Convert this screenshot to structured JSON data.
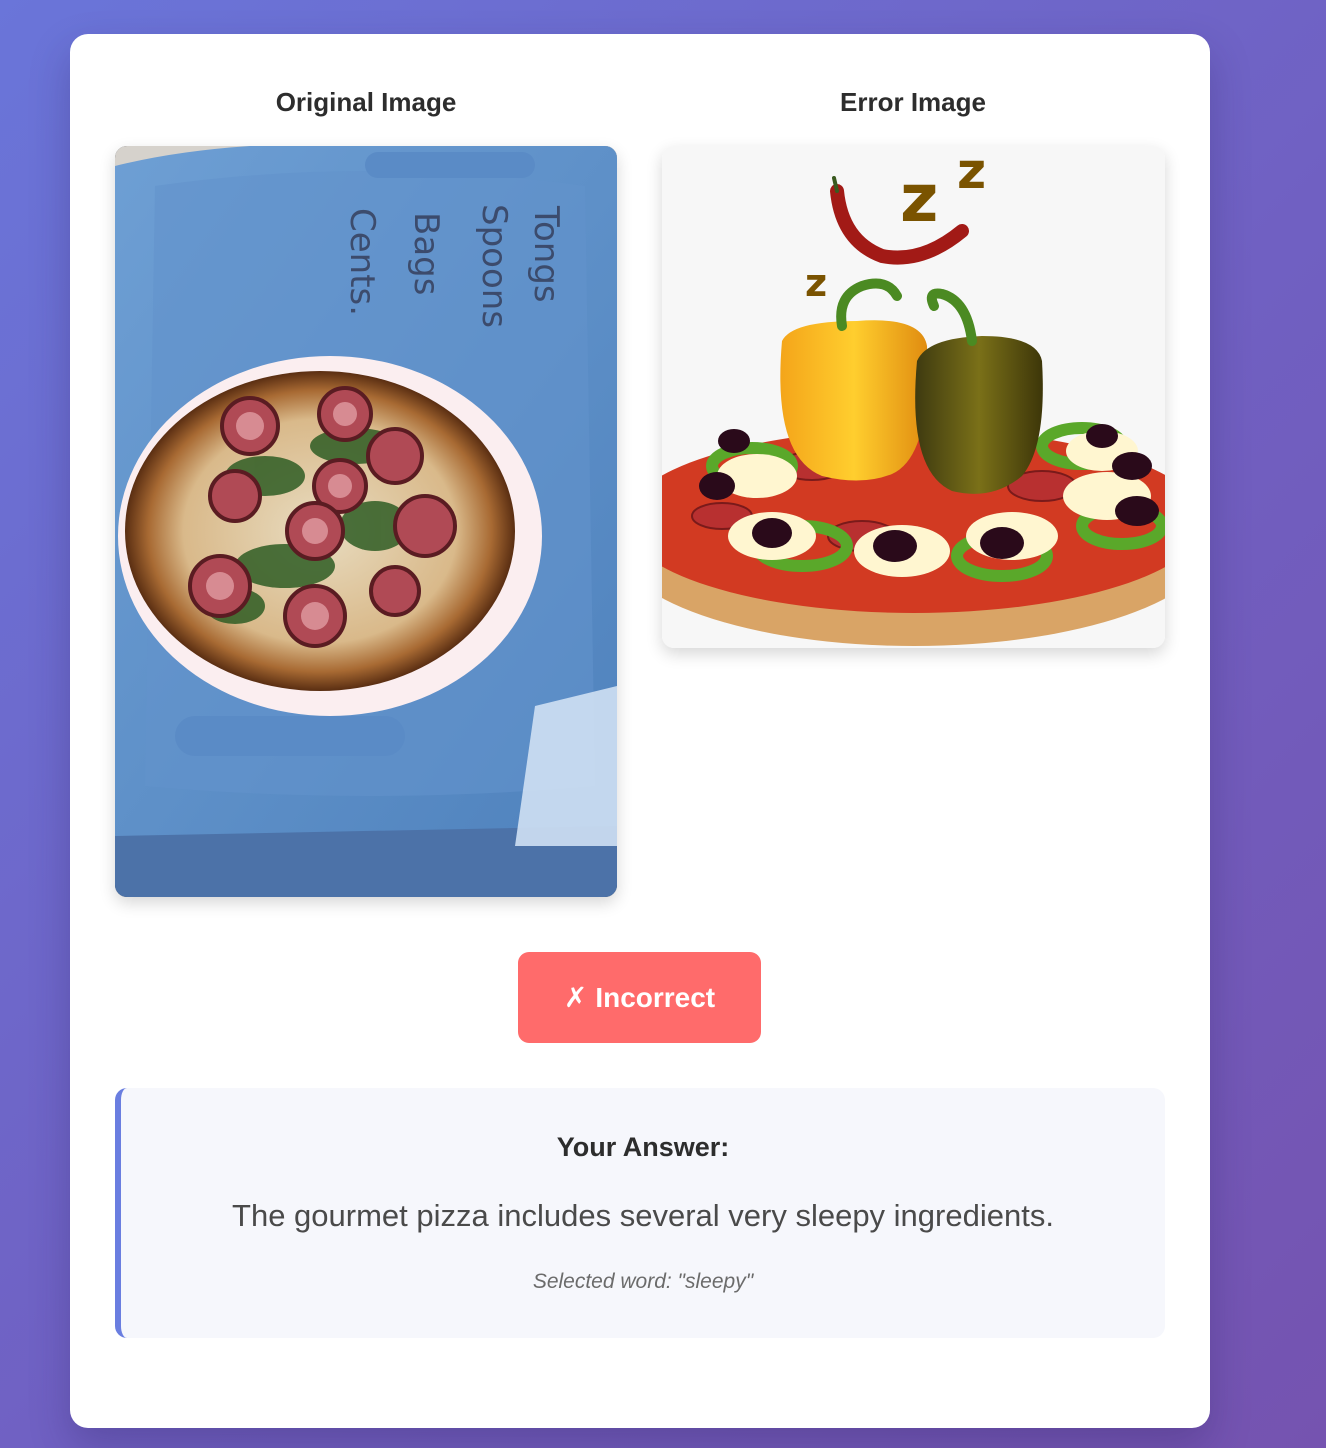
{
  "panels": {
    "original_title": "Original Image",
    "error_title": "Error Image",
    "original_image_alt": "pizza with radishes and greens on a paper plate atop a blue bin lid",
    "error_image_alt": "pizza topped with olives, salami, peppers and floating z letters",
    "lid_writing": [
      "Tongs",
      "Spoons",
      "Bags",
      "Cents."
    ],
    "sleep_letters": [
      "z",
      "z",
      "z"
    ]
  },
  "result": {
    "icon": "✗",
    "label": "Incorrect",
    "color": "#ff6b6b"
  },
  "answer": {
    "heading": "Your Answer:",
    "text": "The gourmet pizza includes several very sleepy ingredients.",
    "selected_word": "Selected word: \"sleepy\""
  },
  "colors": {
    "accent": "#6a7ee0",
    "background_start": "#6a75d9",
    "background_end": "#7553b0"
  }
}
